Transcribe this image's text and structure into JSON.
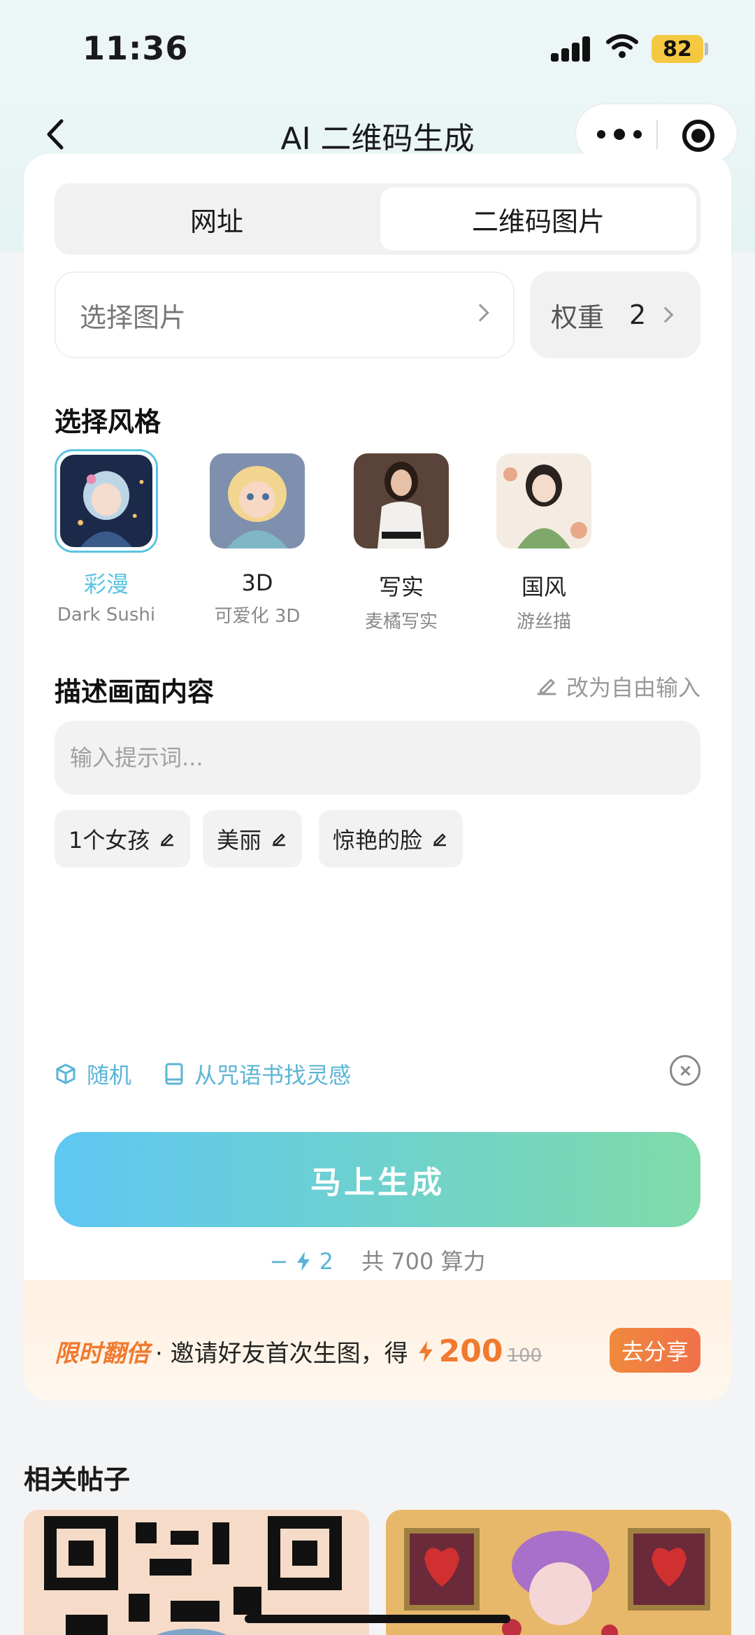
{
  "status_bar": {
    "time": "11:36",
    "battery": "82"
  },
  "nav": {
    "title": "AI 二维码生成"
  },
  "source_tabs": [
    {
      "label": "网址",
      "selected": false
    },
    {
      "label": "二维码图片",
      "selected": true
    }
  ],
  "image_picker": {
    "placeholder": "选择图片"
  },
  "weight": {
    "label": "权重",
    "value": "2"
  },
  "style_section": {
    "title": "选择风格",
    "styles": [
      {
        "name": "彩漫",
        "sub": "Dark Sushi",
        "selected": true
      },
      {
        "name": "3D",
        "sub": "可爱化 3D",
        "selected": false
      },
      {
        "name": "写实",
        "sub": "麦橘写实",
        "selected": false
      },
      {
        "name": "国风",
        "sub": "游丝描",
        "selected": false
      }
    ]
  },
  "describe_section": {
    "title": "描述画面内容",
    "free_input_label": "改为自由输入",
    "prompt_placeholder": "输入提示词...",
    "tags": [
      "1个女孩",
      "美丽",
      "惊艳的脸"
    ]
  },
  "actions": {
    "random_label": "随机",
    "spellbook_label": "从咒语书找灵感"
  },
  "generate": {
    "button_label": "马上生成",
    "cost_label": "−",
    "cost_value": "2",
    "total_label": "共 700 算力"
  },
  "promo": {
    "hot_label": "限时翻倍",
    "text": "· 邀请好友首次生图，得",
    "amount": "200",
    "old_amount": "100",
    "share_label": "去分享"
  },
  "related": {
    "title": "相关帖子"
  },
  "colors": {
    "accent": "#5bc3e2",
    "promo": "#f07a2f",
    "gradient_start": "#5ec7f3",
    "gradient_end": "#7fdba9"
  }
}
